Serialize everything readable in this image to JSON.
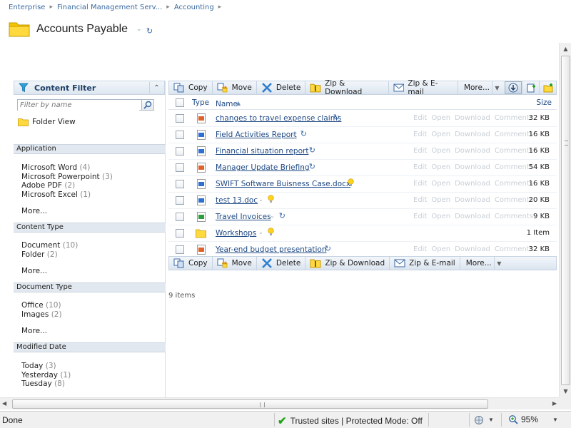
{
  "breadcrumb": [
    "Enterprise",
    "Financial Management Serv...",
    "Accounting"
  ],
  "page": {
    "title": "Accounts Payable"
  },
  "filter": {
    "title": "Content Filter",
    "search_placeholder": "Filter by name",
    "folder_view": "Folder View",
    "sections": [
      {
        "title": "Application",
        "items": [
          {
            "label": "Microsoft Word",
            "count": "(4)"
          },
          {
            "label": "Microsoft Powerpoint",
            "count": "(3)"
          },
          {
            "label": "Adobe PDF",
            "count": "(2)"
          },
          {
            "label": "Microsoft Excel",
            "count": "(1)"
          }
        ],
        "more": "More..."
      },
      {
        "title": "Content Type",
        "items": [
          {
            "label": "Document",
            "count": "(10)"
          },
          {
            "label": "Folder",
            "count": "(2)"
          }
        ],
        "more": "More..."
      },
      {
        "title": "Document Type",
        "items": [
          {
            "label": "Office",
            "count": "(10)"
          },
          {
            "label": "Images",
            "count": "(2)"
          }
        ],
        "more": "More..."
      },
      {
        "title": "Modified Date",
        "items": [
          {
            "label": "Today",
            "count": "(3)"
          },
          {
            "label": "Yesterday",
            "count": "(1)"
          },
          {
            "label": "Tuesday",
            "count": "(8)"
          }
        ]
      }
    ]
  },
  "toolbar": {
    "copy": "Copy",
    "move": "Move",
    "delete": "Delete",
    "zip_download": "Zip & Download",
    "zip_email": "Zip & E-mail",
    "more": "More..."
  },
  "grid": {
    "headers": {
      "type": "Type",
      "name": "Name",
      "size": "Size"
    },
    "actions": [
      "Edit",
      "Open",
      "Download",
      "Comments"
    ],
    "rows": [
      {
        "name": "changes to travel expense claims",
        "type": "powerpoint",
        "marker": "refresh",
        "size": "32 KB"
      },
      {
        "name": "Field Activities Report",
        "type": "word",
        "marker": "refresh",
        "size": "16 KB"
      },
      {
        "name": "Financial situation report",
        "type": "word",
        "marker": "refresh",
        "size": "16 KB"
      },
      {
        "name": "Manager Update Briefing",
        "type": "powerpoint",
        "marker": "refresh",
        "size": "54 KB"
      },
      {
        "name": "SWIFT Software Buisness Case.docx",
        "type": "word",
        "marker": "bulb",
        "size": "16 KB"
      },
      {
        "name": "test 13.doc",
        "type": "word",
        "marker": "bulb",
        "size": "20 KB"
      },
      {
        "name": "Travel Invoices",
        "type": "excel",
        "marker": "refresh",
        "size": "9 KB"
      },
      {
        "name": "Workshops",
        "type": "folder",
        "marker": "bulb",
        "size": "1 Item"
      },
      {
        "name": "Year-end budget presentation",
        "type": "powerpoint",
        "marker": "refresh",
        "size": "32 KB"
      }
    ],
    "item_count": "9 items"
  },
  "status": {
    "text": "Done",
    "zone": "Trusted sites | Protected Mode: Off",
    "zoom": "95%"
  },
  "colors": {
    "link": "#1f4a85",
    "accent": "#3b6aa0",
    "folder": "#f5c400",
    "disabled": "#c8cfd6"
  }
}
